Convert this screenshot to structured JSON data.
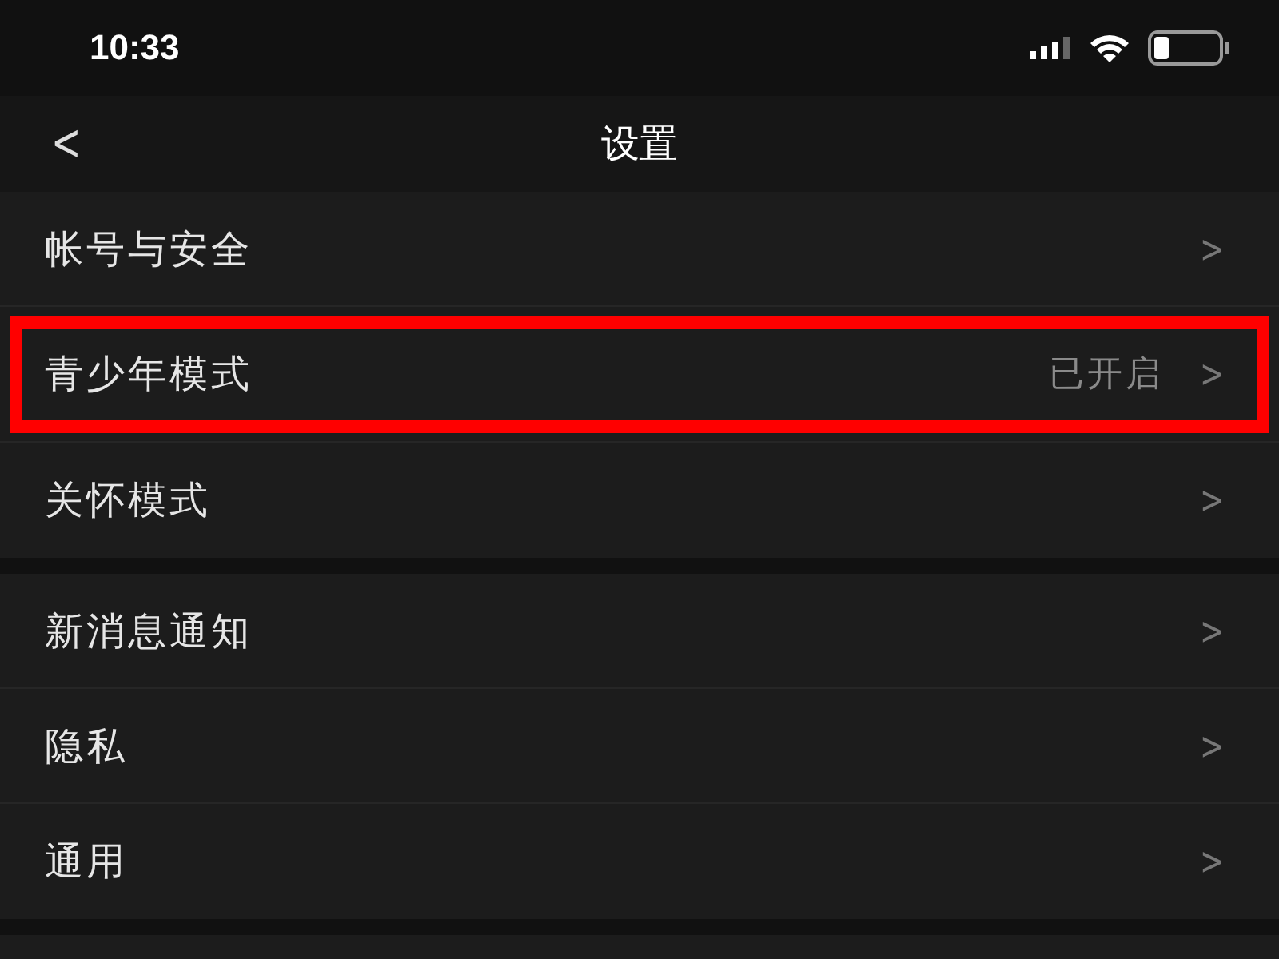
{
  "status_bar": {
    "time": "10:33"
  },
  "nav": {
    "back": "<",
    "title": "设置"
  },
  "groups": [
    {
      "items": [
        {
          "label": "帐号与安全",
          "chevron": ">",
          "highlighted": false
        },
        {
          "label": "青少年模式",
          "value": "已开启",
          "chevron": ">",
          "highlighted": true
        },
        {
          "label": "关怀模式",
          "chevron": ">",
          "highlighted": false
        }
      ]
    },
    {
      "items": [
        {
          "label": "新消息通知",
          "chevron": ">",
          "highlighted": false
        },
        {
          "label": "隐私",
          "chevron": ">",
          "highlighted": false
        },
        {
          "label": "通用",
          "chevron": ">",
          "highlighted": false
        }
      ]
    }
  ]
}
